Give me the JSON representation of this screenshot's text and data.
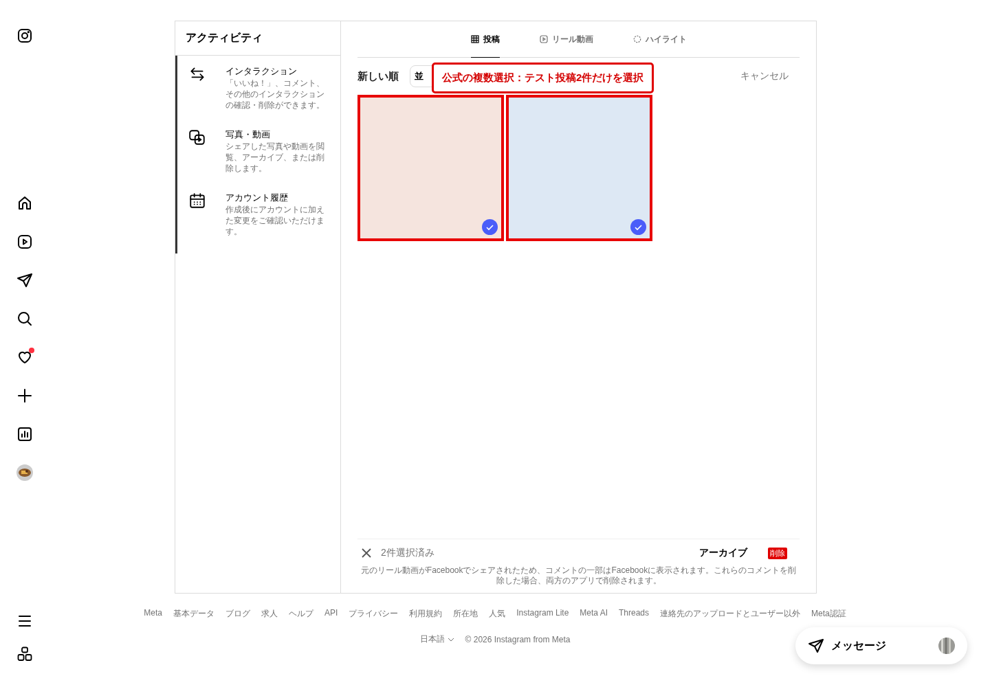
{
  "nav": {
    "notification_dot": true
  },
  "activity_panel": {
    "title": "アクティビティ",
    "list_selected": true,
    "items": [
      {
        "kind": "interactions",
        "title": "インタラクション",
        "description": "「いいね！」、コメント、その他のインタラクションの確認・削除ができます。"
      },
      {
        "kind": "media",
        "title": "写真・動画",
        "description": "シェアした写真や動画を閲覧、アーカイブ、または削除します。"
      },
      {
        "kind": "history",
        "title": "アカウント履歴",
        "description": "作成後にアカウントに加えた変更をご確認いただけます。"
      }
    ]
  },
  "tabs": [
    {
      "kind": "grid",
      "label": "投稿",
      "selected": true
    },
    {
      "kind": "reel",
      "label": "リール動画",
      "selected": false
    },
    {
      "kind": "highlight",
      "label": "ハイライト",
      "selected": false
    }
  ],
  "toolbar": {
    "sort_label": "新しい順",
    "sort_button": "並",
    "cancel": "キャンセル"
  },
  "annotation": "公式の複数選択：テスト投稿2件だけを選択",
  "posts": [
    {
      "color": "#f5e4de",
      "selected": true
    },
    {
      "color": "#dde8f4",
      "selected": true
    }
  ],
  "selection_bar": {
    "count": "2件選択済み",
    "archive": "アーカイブ",
    "delete": "削除",
    "note": "元のリール動画がFacebookでシェアされたため、コメントの一部はFacebookに表示されます。これらのコメントを削除した場合、両方のアプリで削除されます。"
  },
  "footer": {
    "links": [
      "Meta",
      "基本データ",
      "ブログ",
      "求人",
      "ヘルプ",
      "API",
      "プライバシー",
      "利用規約",
      "所在地",
      "人気",
      "Instagram Lite",
      "Meta AI",
      "Threads",
      "連絡先のアップロードとユーザー以外",
      "Meta認証"
    ],
    "language": "日本語",
    "copyright": "© 2026 Instagram from Meta"
  },
  "messages_button": {
    "label": "メッセージ"
  }
}
